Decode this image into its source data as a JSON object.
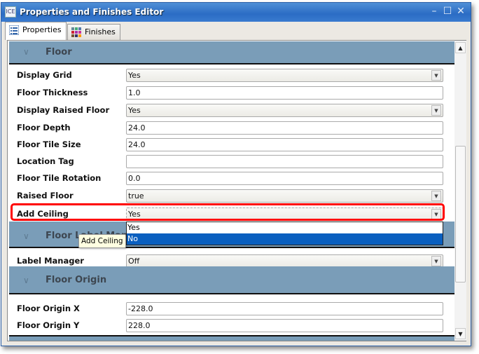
{
  "window": {
    "title": "Properties and Finishes Editor",
    "icon_text": "ICE"
  },
  "tabs": [
    {
      "label": "Properties",
      "active": true
    },
    {
      "label": "Finishes",
      "active": false
    }
  ],
  "sections": [
    {
      "title": "Floor",
      "rows": [
        {
          "label": "Display Grid",
          "value": "Yes",
          "type": "select"
        },
        {
          "label": "Floor Thickness",
          "value": "1.0",
          "type": "text"
        },
        {
          "label": "Display Raised Floor",
          "value": "Yes",
          "type": "select"
        },
        {
          "label": "Floor Depth",
          "value": "24.0",
          "type": "text"
        },
        {
          "label": "Floor Tile Size",
          "value": "24.0",
          "type": "text"
        },
        {
          "label": "Location Tag",
          "value": "",
          "type": "text"
        },
        {
          "label": "Floor Tile Rotation",
          "value": "0.0",
          "type": "text"
        },
        {
          "label": "Raised Floor",
          "value": "true",
          "type": "select"
        },
        {
          "label": "Add Ceiling",
          "value": "Yes",
          "type": "select"
        }
      ]
    },
    {
      "title": "Floor Label Manager",
      "rows": [
        {
          "label": "Label Manager",
          "value": "Off",
          "type": "select"
        }
      ]
    },
    {
      "title": "Floor Origin",
      "rows": [
        {
          "label": "Floor Origin X",
          "value": "-228.0",
          "type": "text"
        },
        {
          "label": "Floor Origin Y",
          "value": "228.0",
          "type": "text"
        }
      ]
    }
  ],
  "dropdown": {
    "options": [
      "Yes",
      "No"
    ],
    "highlighted": "No",
    "highlight_color": "#0a5fbf"
  },
  "tooltip": "Add Ceiling",
  "highlight_color": "#ff0000"
}
